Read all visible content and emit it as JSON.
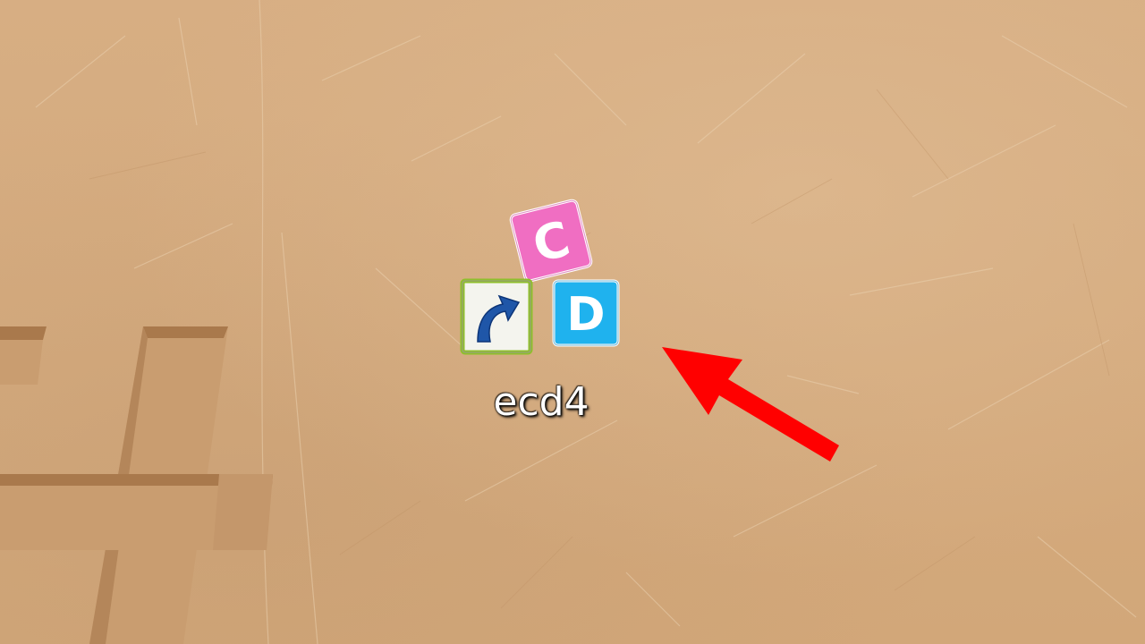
{
  "desktop": {
    "background_color": "#d3a97c",
    "icons": [
      {
        "label": "ecd4",
        "icon": "ecd4-app-icon",
        "shortcut_overlay": "shortcut-arrow-icon",
        "blocks": [
          {
            "letter": "C",
            "color": "#f06ec2"
          },
          {
            "letter": "D",
            "color": "#1fb2ee"
          }
        ]
      }
    ]
  },
  "annotation": {
    "icon": "red-arrow-pointer",
    "color": "#ff0000"
  }
}
